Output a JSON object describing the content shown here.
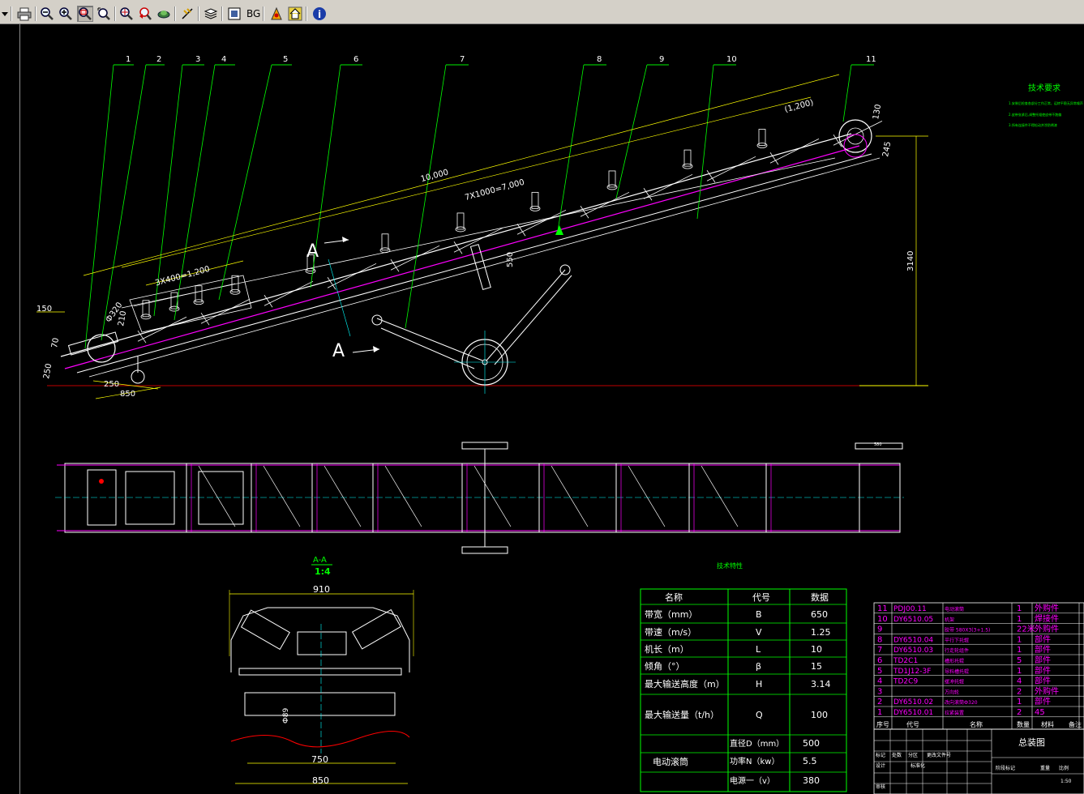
{
  "toolbar": {
    "buttons": [
      {
        "name": "dropdown-arrow-icon"
      },
      {
        "name": "print-icon"
      },
      {
        "name": "zoom-out-icon"
      },
      {
        "name": "zoom-in-icon"
      },
      {
        "name": "zoom-window-icon",
        "pressed": true
      },
      {
        "name": "zoom-realtime-icon"
      },
      {
        "name": "zoom-extents-icon"
      },
      {
        "name": "zoom-previous-icon"
      },
      {
        "name": "pan-icon"
      },
      {
        "name": "measure-icon"
      },
      {
        "name": "layers-icon"
      },
      {
        "name": "view-icon"
      },
      {
        "name": "background-color-button"
      },
      {
        "name": "bookmark-icon"
      },
      {
        "name": "home-icon"
      },
      {
        "name": "info-icon"
      }
    ],
    "bg_label": "BG"
  },
  "drawing": {
    "balloons": [
      "1",
      "2",
      "3",
      "4",
      "5",
      "6",
      "7",
      "8",
      "9",
      "10",
      "11"
    ],
    "dim_total": "10,000",
    "dim_pitch": "7X1000=7,000",
    "dim_short": "3X400=1,200",
    "dim_1200": "(1,200)",
    "dim_height": "3140",
    "dim_150": "150",
    "dim_320": "Ф320",
    "dim_250": "250",
    "dim_850": "850",
    "dim_550": "550",
    "dim_130": "130",
    "dim_245": "245",
    "dim_210": "210",
    "dim_70": "70",
    "dim_250b": "250",
    "section_letter": "A",
    "tech_req_title": "技术要求",
    "tech_req_lines": [
      "1.安装后检查各部分工作正常，运转平稳无异常噪声",
      "2.皮带张紧后,调整托辊使皮带不跑偏",
      "3.所有连接件不得松动并涂防锈漆"
    ],
    "section_title": "A-A",
    "section_scale": "1:4",
    "tech_params_title": "技术特性",
    "aa_dim_910": "910",
    "aa_dim_750": "750",
    "aa_dim_850": "850",
    "aa_dim_89": "Ф89",
    "plan_dim_top": "580"
  },
  "params_table": {
    "headers": [
      "名称",
      "代号",
      "数据"
    ],
    "rows": [
      [
        "带宽（mm）",
        "B",
        "650"
      ],
      [
        "带速（m/s）",
        "V",
        "1.25"
      ],
      [
        "机长（m）",
        "L",
        "10"
      ],
      [
        "倾角（°）",
        "β",
        "15"
      ],
      [
        "最大输送高度（m）",
        "H",
        "3.14"
      ],
      [
        "最大输送量（t/h）",
        "Q",
        "100"
      ]
    ],
    "motor_label": "电动滚筒",
    "motor_rows": [
      [
        "直径D（mm）",
        "500"
      ],
      [
        "功率N（kw）",
        "5.5"
      ],
      [
        "电源一（v）",
        "380"
      ]
    ]
  },
  "parts_list": {
    "rows": [
      [
        "11",
        "PDJ00.11",
        "电动滚筒",
        "1",
        "外购件"
      ],
      [
        "10",
        "DY6510.05",
        "机架",
        "1",
        "焊接件"
      ],
      [
        "9",
        "",
        "胶带 580X3(3+1.5)",
        "22米",
        "外购件"
      ],
      [
        "8",
        "DY6510.04",
        "平行下托辊",
        "1",
        "部件"
      ],
      [
        "7",
        "DY6510.03",
        "行走轮组件",
        "1",
        "部件"
      ],
      [
        "6",
        "TD2C1",
        "槽形托辊",
        "5",
        "部件"
      ],
      [
        "5",
        "TD1J12-3F",
        "导料槽托辊",
        "1",
        "部件"
      ],
      [
        "4",
        "TD2C9",
        "缓冲托辊",
        "4",
        "部件"
      ],
      [
        "3",
        "",
        "万向轮",
        "2",
        "外购件"
      ],
      [
        "2",
        "DY6510.02",
        "改向滚筒Ф320",
        "1",
        "部件"
      ],
      [
        "1",
        "DY6510.01",
        "拉紧装置",
        "2",
        "45"
      ]
    ],
    "footer": [
      "序号",
      "代号",
      "名称",
      "数量",
      "材料",
      "备注"
    ],
    "title_block": "总装图",
    "tb_labels": [
      "标记",
      "处数",
      "分区",
      "更改文件号",
      "设计",
      "标准化",
      "审核",
      "阶段标记",
      "重量",
      "比例",
      "1:50"
    ]
  }
}
